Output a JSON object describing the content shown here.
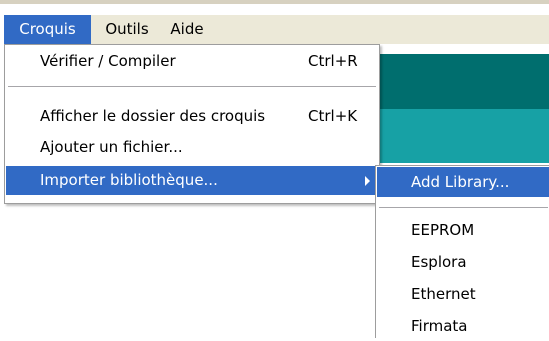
{
  "menubar": {
    "items": [
      {
        "label": "Croquis",
        "active": true
      },
      {
        "label": "Outils",
        "active": false
      },
      {
        "label": "Aide",
        "active": false
      }
    ]
  },
  "croquis_menu": {
    "items": [
      {
        "label": "Vérifier / Compiler",
        "shortcut": "Ctrl+R"
      },
      {
        "label": "Afficher le dossier des croquis",
        "shortcut": "Ctrl+K"
      },
      {
        "label": "Ajouter un fichier..."
      },
      {
        "label": "Importer bibliothèque...",
        "highlighted": true,
        "has_submenu": true
      }
    ]
  },
  "library_submenu": {
    "items": [
      {
        "label": "Add Library...",
        "highlighted": true
      },
      {
        "label": "EEPROM"
      },
      {
        "label": "Esplora"
      },
      {
        "label": "Ethernet"
      },
      {
        "label": "Firmata"
      }
    ]
  },
  "colors": {
    "menu_highlight": "#316ac5",
    "menubar_bg": "#ece9d8",
    "editor_dark": "#006e6e",
    "editor_light": "#17a1a5"
  }
}
